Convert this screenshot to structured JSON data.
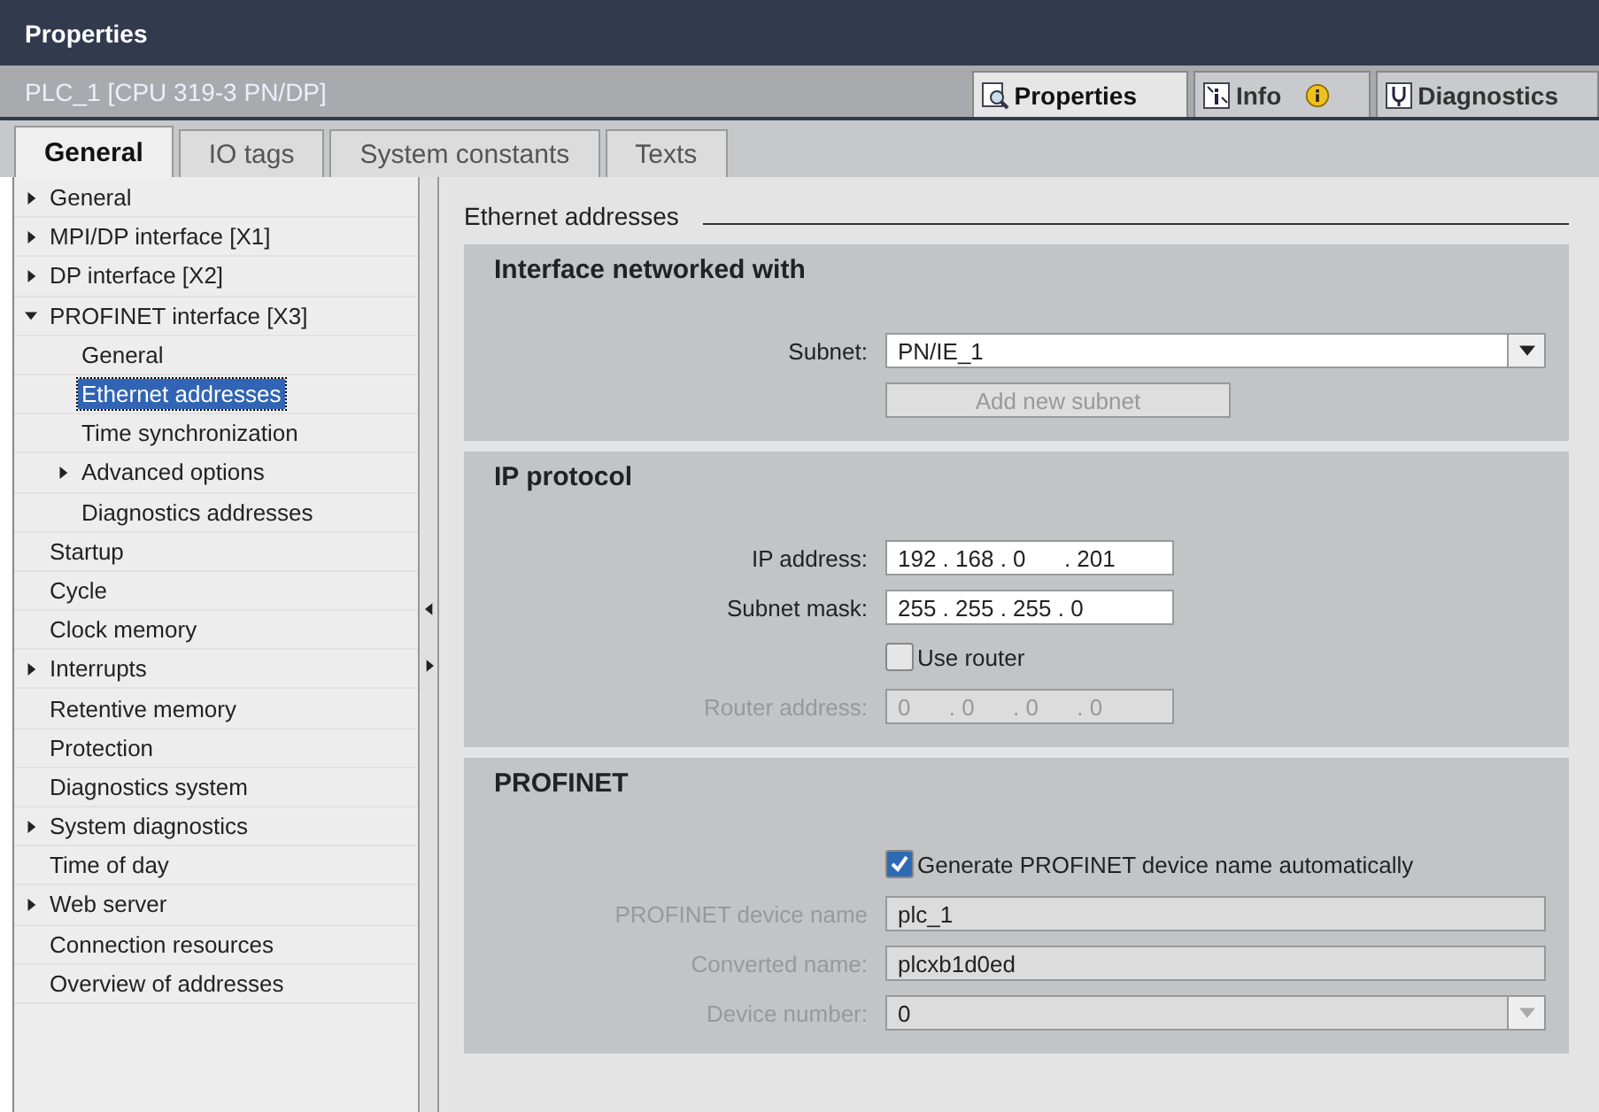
{
  "window": {
    "title": "Properties"
  },
  "object_bar": {
    "title": "PLC_1 [CPU 319-3 PN/DP]",
    "tabs": [
      {
        "label": "Properties",
        "selected": true
      },
      {
        "label": "Info",
        "selected": false
      },
      {
        "label": "Diagnostics",
        "selected": false
      }
    ]
  },
  "tabs": [
    {
      "label": "General",
      "selected": true
    },
    {
      "label": "IO tags",
      "selected": false
    },
    {
      "label": "System constants",
      "selected": false
    },
    {
      "label": "Texts",
      "selected": false
    }
  ],
  "sidebar": {
    "items": [
      {
        "label": "General",
        "expanded": false,
        "selected": false
      },
      {
        "label": "MPI/DP interface [X1]",
        "expanded": false,
        "selected": false
      },
      {
        "label": "DP interface [X2]",
        "expanded": false,
        "selected": false
      },
      {
        "label": "PROFINET interface [X3]",
        "expanded": true,
        "selected": false,
        "children": [
          {
            "label": "General",
            "selected": false
          },
          {
            "label": "Ethernet addresses",
            "selected": true
          },
          {
            "label": "Time synchronization",
            "selected": false
          },
          {
            "label": "Advanced options",
            "expanded": false,
            "selected": false
          },
          {
            "label": "Diagnostics addresses",
            "selected": false
          }
        ]
      },
      {
        "label": "Startup",
        "selected": false
      },
      {
        "label": "Cycle",
        "selected": false
      },
      {
        "label": "Clock memory",
        "selected": false
      },
      {
        "label": "Interrupts",
        "expanded": false,
        "selected": false
      },
      {
        "label": "Retentive memory",
        "selected": false
      },
      {
        "label": "Protection",
        "selected": false
      },
      {
        "label": "Diagnostics system",
        "selected": false
      },
      {
        "label": "System diagnostics",
        "expanded": false,
        "selected": false
      },
      {
        "label": "Time of day",
        "selected": false
      },
      {
        "label": "Web server",
        "expanded": false,
        "selected": false
      },
      {
        "label": "Connection resources",
        "selected": false
      },
      {
        "label": "Overview of addresses",
        "selected": false
      }
    ]
  },
  "content": {
    "heading": "Ethernet addresses",
    "sections": [
      {
        "title": "Interface networked with",
        "rows": [
          {
            "kind": "dropdown",
            "label": "Subnet:",
            "value": "PN/IE_1",
            "disabled": false
          },
          {
            "kind": "button",
            "label": "Add new subnet",
            "disabled": true
          }
        ]
      },
      {
        "title": "IP protocol",
        "rows": [
          {
            "kind": "ip",
            "label": "IP address:",
            "value": "192 . 168 . 0      . 201",
            "disabled": false
          },
          {
            "kind": "ip",
            "label": "Subnet mask:",
            "value": "255 . 255 . 255 . 0",
            "disabled": false
          },
          {
            "kind": "checkbox",
            "label": "Use router",
            "checked": false
          },
          {
            "kind": "ip",
            "label": "Router address:",
            "value": "0      . 0      . 0      . 0",
            "disabled": true
          }
        ]
      },
      {
        "title": "PROFINET",
        "rows": [
          {
            "kind": "checkbox",
            "label": "Generate PROFINET device name automatically",
            "checked": true
          },
          {
            "kind": "text",
            "label": "PROFINET device name",
            "value": "plc_1",
            "disabled": true
          },
          {
            "kind": "text",
            "label": "Converted name:",
            "value": "plcxb1d0ed",
            "disabled": true
          },
          {
            "kind": "dropdown",
            "label": "Device number:",
            "value": "0",
            "disabled": true
          }
        ]
      }
    ]
  }
}
